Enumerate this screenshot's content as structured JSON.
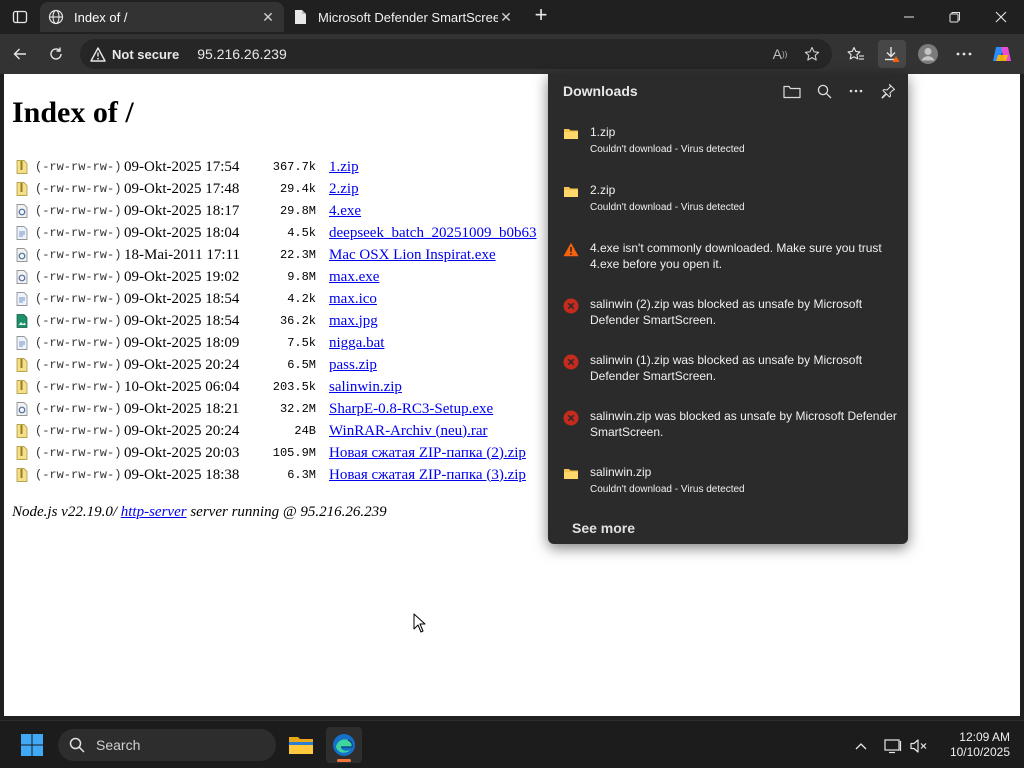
{
  "browser": {
    "tabs": [
      {
        "title": "Index of /",
        "active": true
      },
      {
        "title": "Microsoft Defender SmartScreen",
        "active": false
      }
    ],
    "address": {
      "security_label": "Not secure",
      "url": "95.216.26.239"
    }
  },
  "page": {
    "heading": "Index of /",
    "files": [
      {
        "perm": "(-rw-rw-rw-)",
        "date": "09-Okt-2025 17:54",
        "size": "367.7k",
        "name": "1.zip",
        "icon": "zip-file-icon"
      },
      {
        "perm": "(-rw-rw-rw-)",
        "date": "09-Okt-2025 17:48",
        "size": "29.4k",
        "name": "2.zip",
        "icon": "zip-file-icon"
      },
      {
        "perm": "(-rw-rw-rw-)",
        "date": "09-Okt-2025 18:17",
        "size": "29.8M",
        "name": "4.exe",
        "icon": "exe-file-icon"
      },
      {
        "perm": "(-rw-rw-rw-)",
        "date": "09-Okt-2025 18:04",
        "size": "4.5k",
        "name": "deepseek_batch_20251009_b0b63",
        "icon": "text-file-icon"
      },
      {
        "perm": "(-rw-rw-rw-)",
        "date": "18-Mai-2011 17:11",
        "size": "22.3M",
        "name": "Mac OSX Lion Inspirat.exe",
        "icon": "exe-file-icon"
      },
      {
        "perm": "(-rw-rw-rw-)",
        "date": "09-Okt-2025 19:02",
        "size": "9.8M",
        "name": "max.exe",
        "icon": "exe-file-icon"
      },
      {
        "perm": "(-rw-rw-rw-)",
        "date": "09-Okt-2025 18:54",
        "size": "4.2k",
        "name": "max.ico",
        "icon": "text-file-icon"
      },
      {
        "perm": "(-rw-rw-rw-)",
        "date": "09-Okt-2025 18:54",
        "size": "36.2k",
        "name": "max.jpg",
        "icon": "image-file-icon"
      },
      {
        "perm": "(-rw-rw-rw-)",
        "date": "09-Okt-2025 18:09",
        "size": "7.5k",
        "name": "nigga.bat",
        "icon": "text-file-icon"
      },
      {
        "perm": "(-rw-rw-rw-)",
        "date": "09-Okt-2025 20:24",
        "size": "6.5M",
        "name": "pass.zip",
        "icon": "zip-file-icon"
      },
      {
        "perm": "(-rw-rw-rw-)",
        "date": "10-Okt-2025 06:04",
        "size": "203.5k",
        "name": "salinwin.zip",
        "icon": "zip-file-icon"
      },
      {
        "perm": "(-rw-rw-rw-)",
        "date": "09-Okt-2025 18:21",
        "size": "32.2M",
        "name": "SharpE-0.8-RC3-Setup.exe",
        "icon": "exe-file-icon"
      },
      {
        "perm": "(-rw-rw-rw-)",
        "date": "09-Okt-2025 20:24",
        "size": "24B",
        "name": "WinRAR-Archiv (neu).rar",
        "icon": "zip-file-icon"
      },
      {
        "perm": "(-rw-rw-rw-)",
        "date": "09-Okt-2025 20:03",
        "size": "105.9M",
        "name": "Новая сжатая ZIP-папка (2).zip",
        "icon": "zip-file-icon"
      },
      {
        "perm": "(-rw-rw-rw-)",
        "date": "09-Okt-2025 18:38",
        "size": "6.3M",
        "name": "Новая сжатая ZIP-папка (3).zip",
        "icon": "zip-file-icon"
      }
    ],
    "footer": {
      "prefix": "Node.js v22.19.0/ ",
      "link": "http-server",
      "suffix": " server running @ 95.216.26.239"
    }
  },
  "downloads": {
    "title": "Downloads",
    "items": [
      {
        "icon": "folder-icon",
        "text": "1.zip",
        "sub": "Couldn't download - Virus detected"
      },
      {
        "icon": "folder-icon",
        "text": "2.zip",
        "sub": "Couldn't download - Virus detected"
      },
      {
        "icon": "warning-icon",
        "text": "4.exe isn't commonly downloaded. Make sure you trust 4.exe before you open it.",
        "sub": ""
      },
      {
        "icon": "blocked-icon",
        "text": "salinwin (2).zip was blocked as unsafe by Microsoft Defender SmartScreen.",
        "sub": ""
      },
      {
        "icon": "blocked-icon",
        "text": "salinwin (1).zip was blocked as unsafe by Microsoft Defender SmartScreen.",
        "sub": ""
      },
      {
        "icon": "blocked-icon",
        "text": "salinwin.zip was blocked as unsafe by Microsoft Defender SmartScreen.",
        "sub": ""
      },
      {
        "icon": "folder-icon",
        "text": "salinwin.zip",
        "sub": "Couldn't download - Virus detected"
      }
    ],
    "see_more": "See more"
  },
  "taskbar": {
    "search_placeholder": "Search",
    "time": "12:09 AM",
    "date": "10/10/2025"
  },
  "colors": {
    "link": "#0000ee",
    "warning": "#f7630c",
    "blocked": "#c42b1c",
    "folder": "#f5c451",
    "panel_bg": "#2b2b2b"
  }
}
